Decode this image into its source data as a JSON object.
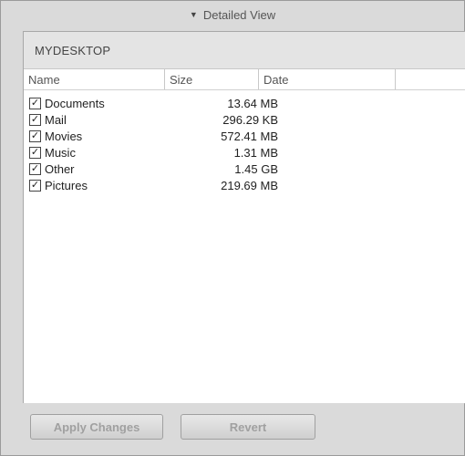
{
  "header": {
    "title": "Detailed View"
  },
  "panel": {
    "title": "MYDESKTOP"
  },
  "columns": {
    "name": "Name",
    "size": "Size",
    "date": "Date",
    "extra": ""
  },
  "rows": [
    {
      "name": "Documents",
      "size": "13.64 MB",
      "checked": true
    },
    {
      "name": "Mail",
      "size": "296.29 KB",
      "checked": true
    },
    {
      "name": "Movies",
      "size": "572.41 MB",
      "checked": true
    },
    {
      "name": "Music",
      "size": "1.31 MB",
      "checked": true
    },
    {
      "name": "Other",
      "size": "1.45 GB",
      "checked": true
    },
    {
      "name": "Pictures",
      "size": "219.69 MB",
      "checked": true
    }
  ],
  "buttons": {
    "apply": "Apply Changes",
    "revert": "Revert"
  }
}
